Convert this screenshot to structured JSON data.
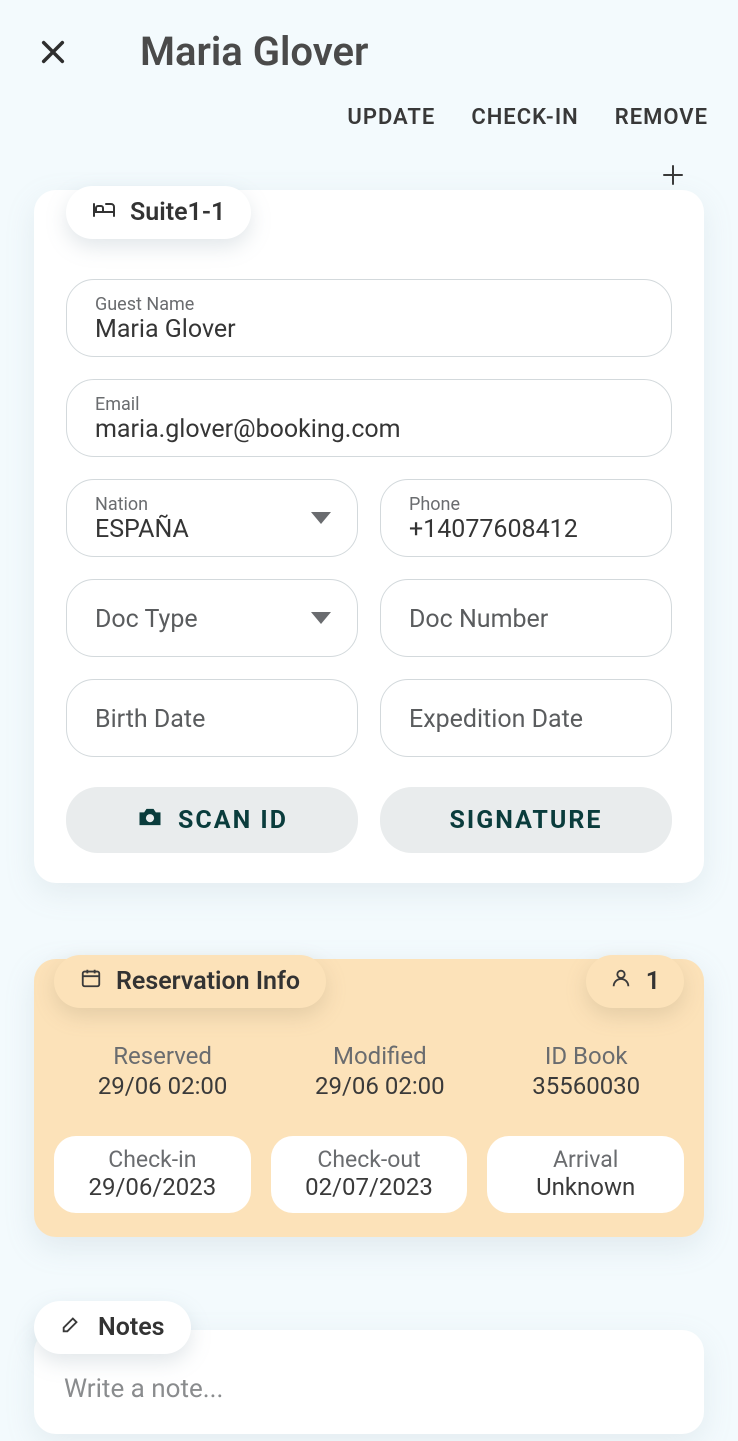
{
  "header": {
    "title": "Maria Glover"
  },
  "actions": {
    "update": "UPDATE",
    "checkin": "CHECK-IN",
    "remove": "REMOVE"
  },
  "suite": {
    "label": "Suite1-1"
  },
  "form": {
    "guest_name": {
      "label": "Guest Name",
      "value": "Maria Glover"
    },
    "email": {
      "label": "Email",
      "value": "maria.glover@booking.com"
    },
    "nation": {
      "label": "Nation",
      "value": "ESPAÑA"
    },
    "phone": {
      "label": "Phone",
      "value": "+14077608412"
    },
    "doc_type": {
      "placeholder": "Doc Type"
    },
    "doc_number": {
      "placeholder": "Doc Number"
    },
    "birth_date": {
      "placeholder": "Birth Date"
    },
    "expedition_date": {
      "placeholder": "Expedition Date"
    }
  },
  "buttons": {
    "scan_id": "SCAN ID",
    "signature": "SIGNATURE"
  },
  "reservation": {
    "title": "Reservation Info",
    "count": "1",
    "reserved": {
      "label": "Reserved",
      "value": "29/06 02:00"
    },
    "modified": {
      "label": "Modified",
      "value": "29/06 02:00"
    },
    "idbook": {
      "label": "ID Book",
      "value": "35560030"
    },
    "checkin": {
      "label": "Check-in",
      "value": "29/06/2023"
    },
    "checkout": {
      "label": "Check-out",
      "value": "02/07/2023"
    },
    "arrival": {
      "label": "Arrival",
      "value": "Unknown"
    }
  },
  "notes": {
    "title": "Notes",
    "placeholder": "Write a note..."
  }
}
